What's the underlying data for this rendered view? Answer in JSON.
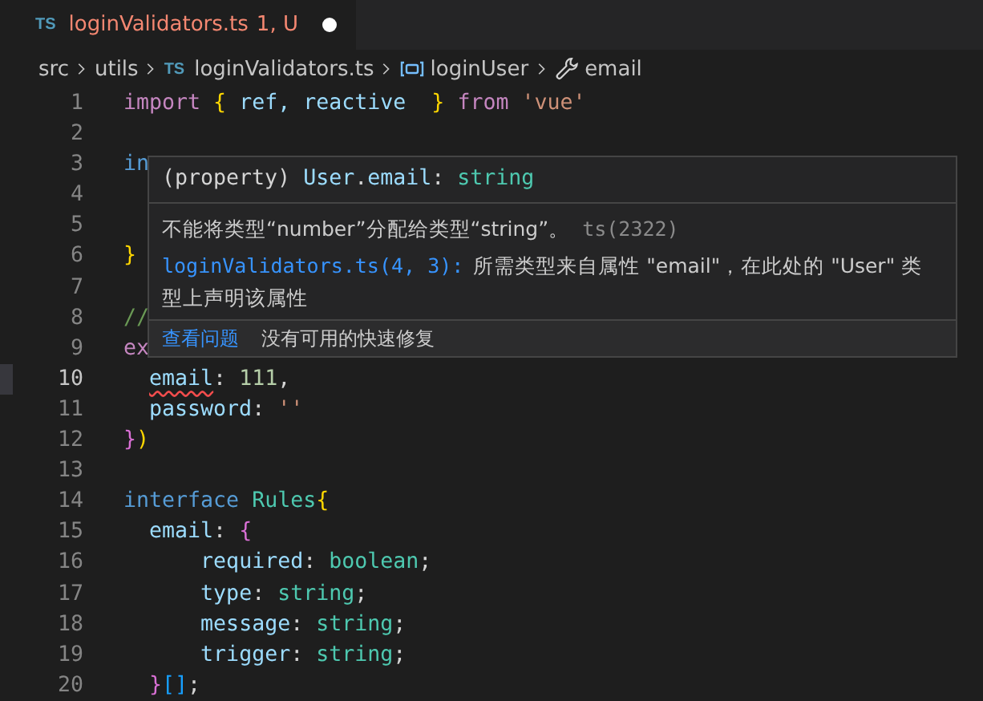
{
  "tab": {
    "icon_text": "TS",
    "title": "loginValidators.ts",
    "badge": "1, U",
    "modified": true,
    "has_error": true
  },
  "breadcrumbs": [
    {
      "kind": "folder",
      "label": "src"
    },
    {
      "kind": "folder",
      "label": "utils"
    },
    {
      "kind": "file",
      "icon_text": "TS",
      "label": "loginValidators.ts"
    },
    {
      "kind": "variable",
      "label": "loginUser"
    },
    {
      "kind": "property",
      "label": "email"
    }
  ],
  "lines": [
    {
      "number": "1",
      "current": false,
      "tokens": [
        {
          "text": "import ",
          "kind": "keyword"
        },
        {
          "text": "{",
          "kind": "brace1"
        },
        {
          "text": " ref, reactive  ",
          "kind": "variable"
        },
        {
          "text": "}",
          "kind": "brace1"
        },
        {
          "text": " from",
          "kind": "keyword"
        },
        {
          "text": " 'vue'",
          "kind": "string"
        }
      ]
    },
    {
      "number": "2",
      "current": false
    },
    {
      "number": "3",
      "current": false,
      "tokens": [
        {
          "text": "in",
          "kind": "storage"
        }
      ]
    },
    {
      "number": "4",
      "current": false
    },
    {
      "number": "5",
      "current": false
    },
    {
      "number": "6",
      "current": false,
      "tokens": [
        {
          "text": "}",
          "kind": "brace1"
        }
      ]
    },
    {
      "number": "7",
      "current": false
    },
    {
      "number": "8",
      "current": false,
      "tokens": [
        {
          "text": "//",
          "kind": "comment"
        }
      ]
    },
    {
      "number": "9",
      "current": false,
      "tokens": [
        {
          "text": "ex",
          "kind": "keyword"
        }
      ]
    },
    {
      "number": "10",
      "current": true,
      "tokens": [
        {
          "text": "  email",
          "kind": "error"
        },
        {
          "text": ": ",
          "kind": "plain"
        },
        {
          "text": "111",
          "kind": "number"
        },
        {
          "text": ",",
          "kind": "plain"
        }
      ]
    },
    {
      "number": "11",
      "current": false,
      "tokens": [
        {
          "text": "  password",
          "kind": "variable"
        },
        {
          "text": ": ",
          "kind": "plain"
        },
        {
          "text": "''",
          "kind": "string"
        }
      ]
    },
    {
      "number": "12",
      "current": false,
      "tokens": [
        {
          "text": "}",
          "kind": "brace2"
        },
        {
          "text": ")",
          "kind": "brace1"
        }
      ]
    },
    {
      "number": "13",
      "current": false
    },
    {
      "number": "14",
      "current": false,
      "tokens": [
        {
          "text": "interface",
          "kind": "storage"
        },
        {
          "text": " Rules",
          "kind": "type"
        },
        {
          "text": "{",
          "kind": "brace1"
        }
      ]
    },
    {
      "number": "15",
      "current": false,
      "tokens": [
        {
          "text": "  email",
          "kind": "variable"
        },
        {
          "text": ": ",
          "kind": "plain"
        },
        {
          "text": "{",
          "kind": "brace2"
        }
      ]
    },
    {
      "number": "16",
      "current": false,
      "tokens": [
        {
          "text": "      required",
          "kind": "variable"
        },
        {
          "text": ": ",
          "kind": "plain"
        },
        {
          "text": "boolean",
          "kind": "type"
        },
        {
          "text": ";",
          "kind": "plain"
        }
      ]
    },
    {
      "number": "17",
      "current": false,
      "tokens": [
        {
          "text": "      type",
          "kind": "variable"
        },
        {
          "text": ": ",
          "kind": "plain"
        },
        {
          "text": "string",
          "kind": "type"
        },
        {
          "text": ";",
          "kind": "plain"
        }
      ]
    },
    {
      "number": "18",
      "current": false,
      "tokens": [
        {
          "text": "      message",
          "kind": "variable"
        },
        {
          "text": ": ",
          "kind": "plain"
        },
        {
          "text": "string",
          "kind": "type"
        },
        {
          "text": ";",
          "kind": "plain"
        }
      ]
    },
    {
      "number": "19",
      "current": false,
      "tokens": [
        {
          "text": "      trigger",
          "kind": "variable"
        },
        {
          "text": ": ",
          "kind": "plain"
        },
        {
          "text": "string",
          "kind": "type"
        },
        {
          "text": ";",
          "kind": "plain"
        }
      ]
    },
    {
      "number": "20",
      "current": false,
      "tokens": [
        {
          "text": "  }",
          "kind": "brace2"
        },
        {
          "text": "[]",
          "kind": "brace3"
        },
        {
          "text": ";",
          "kind": "plain"
        }
      ]
    }
  ],
  "hover": {
    "signature": [
      {
        "text": "(property) ",
        "kind": "plain"
      },
      {
        "text": "User",
        "kind": "variable"
      },
      {
        "text": ".",
        "kind": "plain"
      },
      {
        "text": "email",
        "kind": "variable"
      },
      {
        "text": ": ",
        "kind": "plain"
      },
      {
        "text": "string",
        "kind": "type"
      }
    ],
    "message": "不能将类型“number”分配给类型“string”。",
    "code": "ts(2322)",
    "related_link": "loginValidators.ts(4, 3):",
    "related_text": "所需类型来自属性 \"email\"，在此处的 \"User\" 类型上声明该属性",
    "actions": [
      {
        "label": "查看问题",
        "kind": "link"
      },
      {
        "label": "没有可用的快速修复",
        "kind": "text"
      }
    ]
  }
}
